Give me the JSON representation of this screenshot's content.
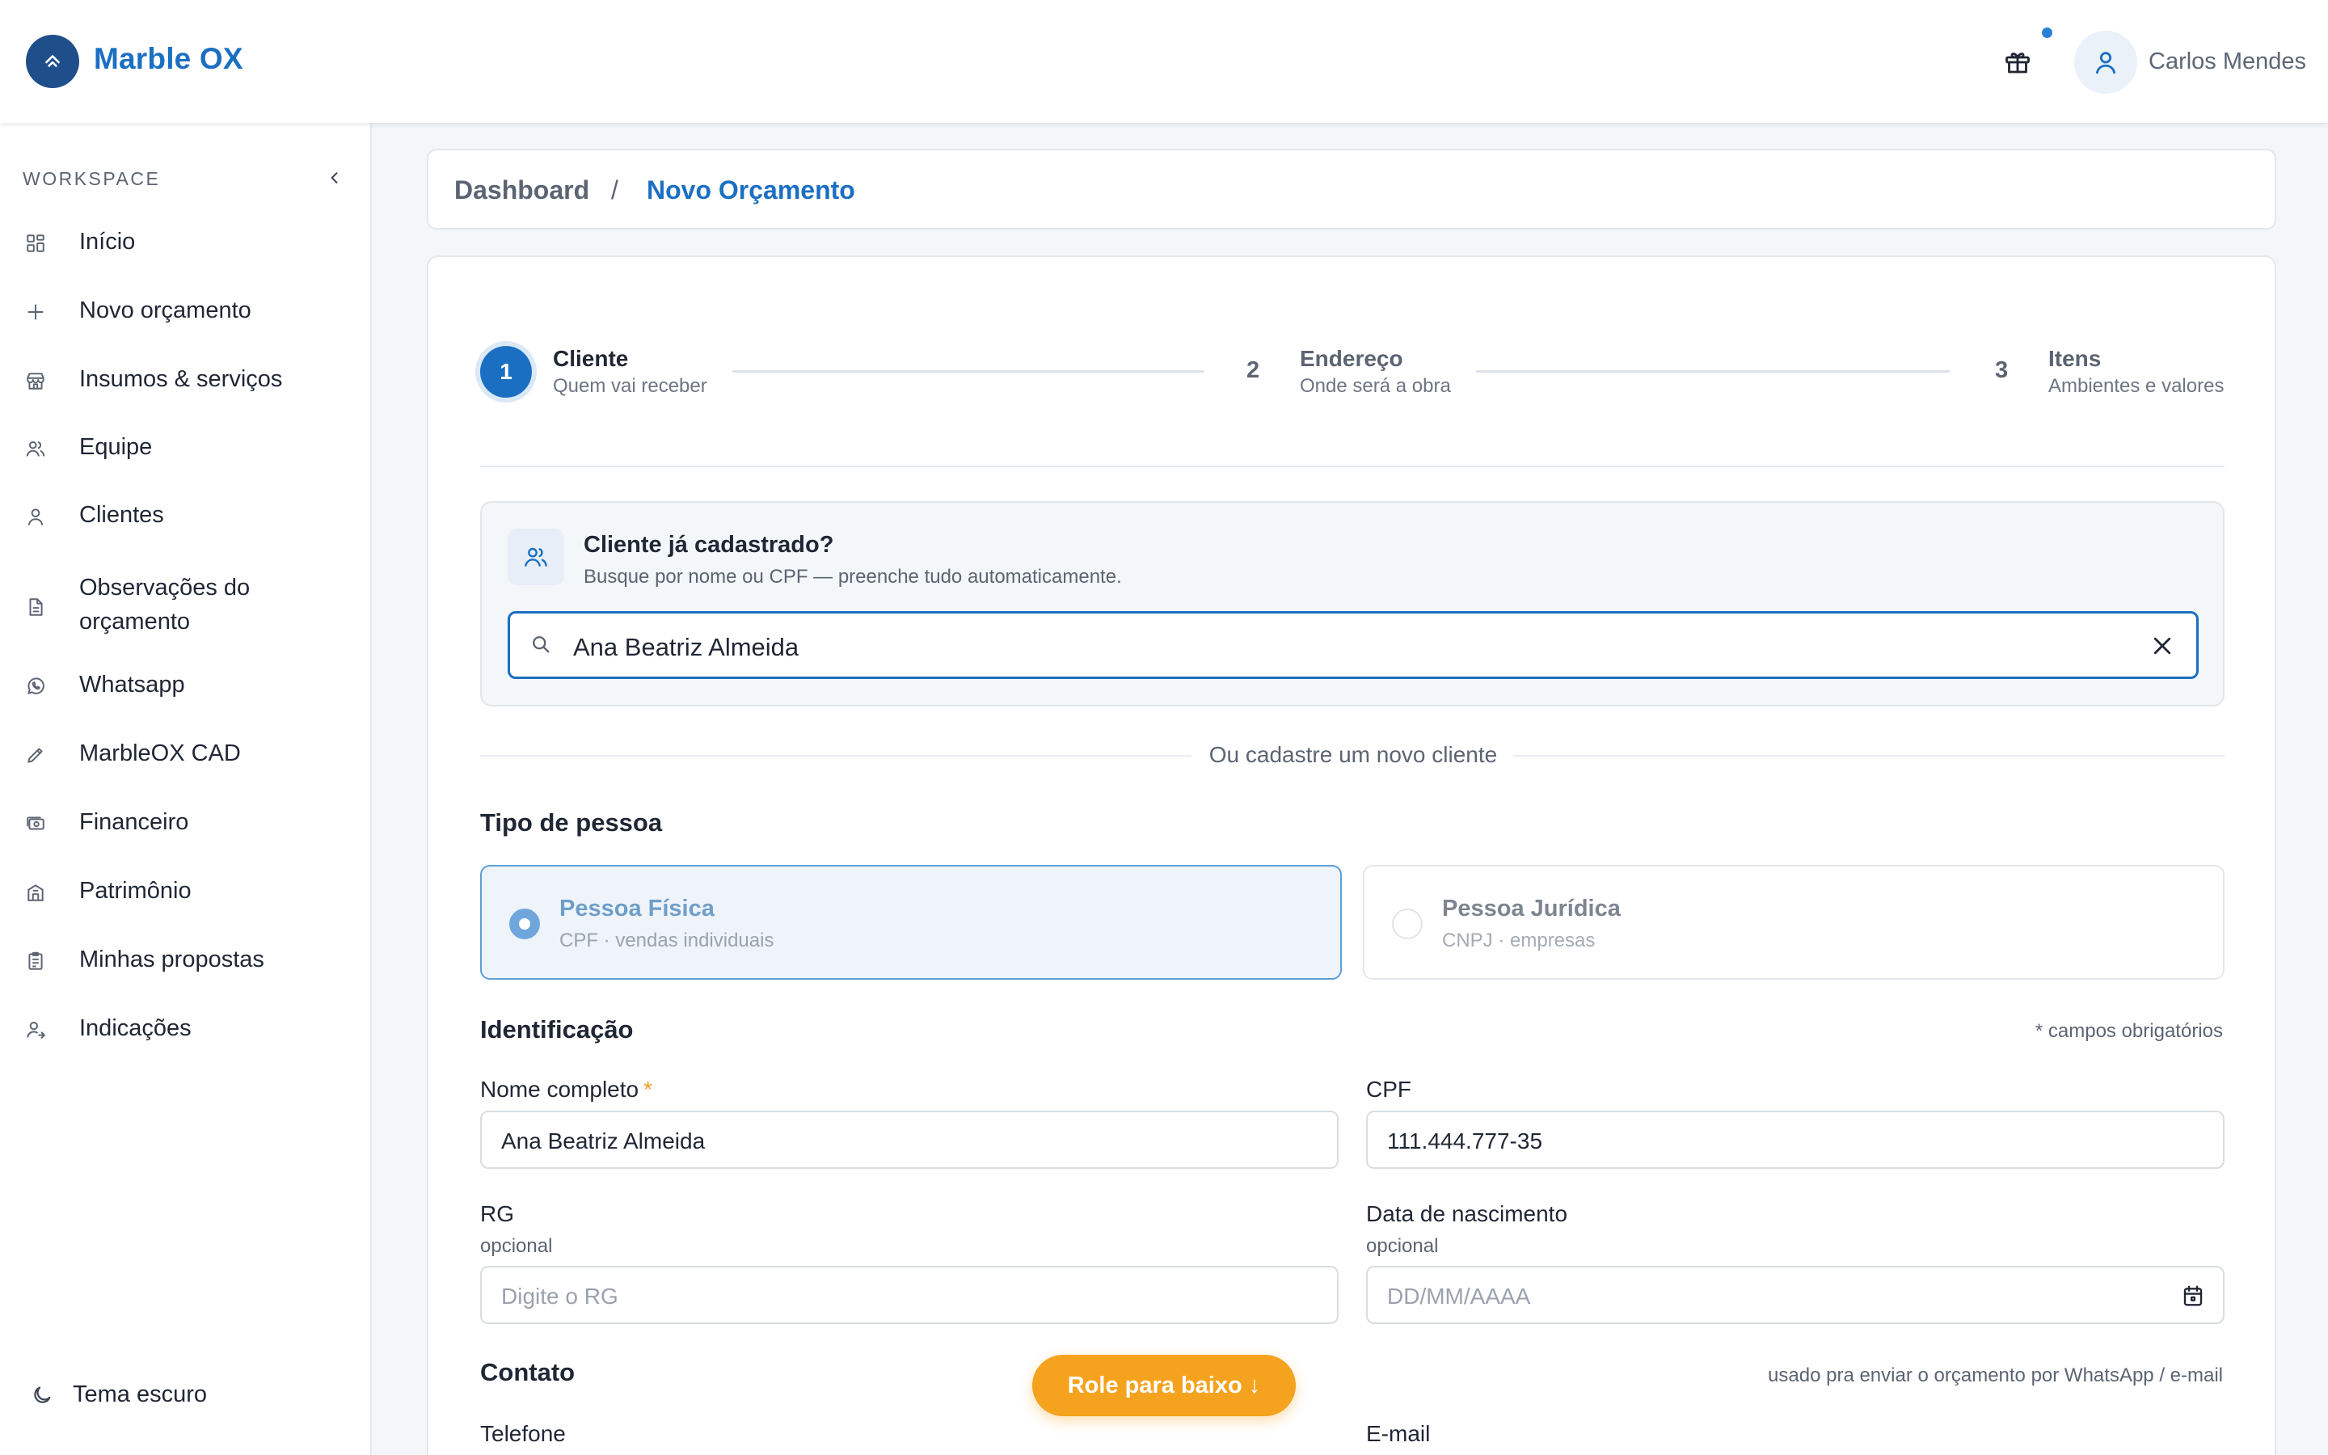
{
  "brand": {
    "name": "Marble OX",
    "accent": "#1b6fc2",
    "logo_bg": "#1f4f8a"
  },
  "header": {
    "user_name": "Carlos Mendes",
    "gift_icon": "gift-icon",
    "user_icon": "user-icon"
  },
  "sidebar": {
    "section_label": "WORKSPACE",
    "items": [
      {
        "label": "Início",
        "icon": "dashboard-grid-icon"
      },
      {
        "label": "Novo orçamento",
        "icon": "plus-icon"
      },
      {
        "label": "Insumos & serviços",
        "icon": "store-icon"
      },
      {
        "label": "Equipe",
        "icon": "team-icon"
      },
      {
        "label": "Clientes",
        "icon": "user-icon"
      },
      {
        "label": "Observações do orçamento",
        "icon": "document-icon"
      },
      {
        "label": "Whatsapp",
        "icon": "whatsapp-icon"
      },
      {
        "label": "MarbleOX CAD",
        "icon": "pencil-icon"
      },
      {
        "label": "Financeiro",
        "icon": "cash-icon"
      },
      {
        "label": "Patrimônio",
        "icon": "building-icon"
      },
      {
        "label": "Minhas propostas",
        "icon": "clipboard-icon"
      },
      {
        "label": "Indicações",
        "icon": "user-referral-icon"
      }
    ],
    "theme_toggle": "Tema escuro"
  },
  "breadcrumb": {
    "home": "Dashboard",
    "separator": "/",
    "current": "Novo Orçamento"
  },
  "stepper": {
    "steps": [
      {
        "number": "1",
        "title": "Cliente",
        "subtitle": "Quem vai receber",
        "active": true
      },
      {
        "number": "2",
        "title": "Endereço",
        "subtitle": "Onde será a obra",
        "active": false
      },
      {
        "number": "3",
        "title": "Itens",
        "subtitle": "Ambientes e valores",
        "active": false
      }
    ]
  },
  "client_search": {
    "title": "Cliente já cadastrado?",
    "subtitle": "Busque por nome ou CPF — preenche tudo automaticamente.",
    "value": "Ana Beatriz Almeida"
  },
  "or_divider": "Ou cadastre um novo cliente",
  "person_type": {
    "heading": "Tipo de pessoa",
    "options": [
      {
        "title": "Pessoa Física",
        "subtitle": "CPF · vendas individuais",
        "selected": true
      },
      {
        "title": "Pessoa Jurídica",
        "subtitle": "CNPJ · empresas",
        "selected": false
      }
    ]
  },
  "identification": {
    "heading": "Identificação",
    "required_note": "* campos obrigatórios",
    "full_name": {
      "label": "Nome completo",
      "required_mark": "*",
      "value": "Ana Beatriz Almeida"
    },
    "cpf": {
      "label": "CPF",
      "value": "111.444.777-35"
    },
    "rg": {
      "label": "RG",
      "hint": "opcional",
      "placeholder": "Digite o RG"
    },
    "birth_date": {
      "label": "Data de nascimento",
      "hint": "opcional",
      "placeholder": "DD/MM/AAAA"
    }
  },
  "contact": {
    "heading": "Contato",
    "note": "usado pra enviar o orçamento por WhatsApp / e-mail",
    "phone_label": "Telefone",
    "email_label": "E-mail"
  },
  "scroll_hint": "Role para baixo ↓"
}
